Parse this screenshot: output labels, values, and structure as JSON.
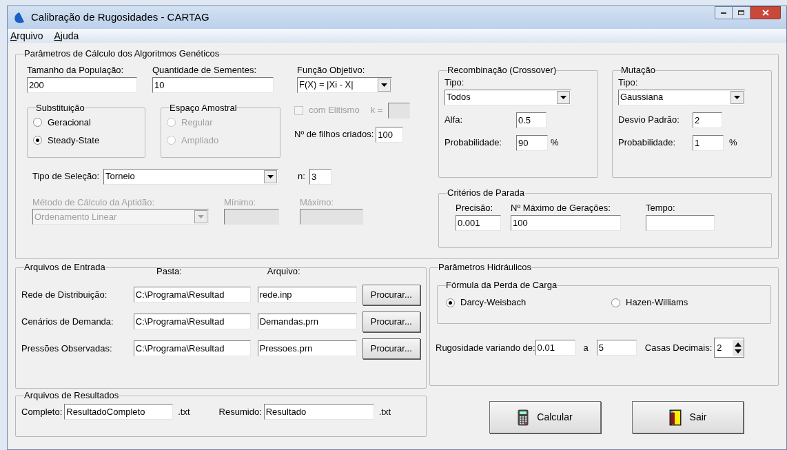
{
  "window": {
    "title": "Calibração de Rugosidades - CARTAG"
  },
  "menu": [
    "Arquivo",
    "Ajuda"
  ],
  "ga": {
    "title": "Parâmetros de Cálculo dos Algoritmos Genéticos",
    "population": {
      "label": "Tamanho da População:",
      "value": "200"
    },
    "seeds": {
      "label": "Quantidade de Sementes:",
      "value": "10"
    },
    "objective": {
      "label": "Função Objetivo:",
      "value": "F(X) = |Xi - X|"
    },
    "replacement": {
      "title": "Substituição",
      "disabled": false,
      "options": [
        {
          "label": "Geracional",
          "selected": false
        },
        {
          "label": "Steady-State",
          "selected": true
        }
      ]
    },
    "sample_space": {
      "title": "Espaço Amostral",
      "disabled": true,
      "options": [
        {
          "label": "Regular",
          "selected": false
        },
        {
          "label": "Ampliado",
          "selected": false
        }
      ]
    },
    "elitism": {
      "label": "com Elitismo",
      "checked": false,
      "disabled": true,
      "k_label": "k ="
    },
    "offspring": {
      "label": "Nº de filhos criados:",
      "value": "100"
    },
    "selection": {
      "label": "Tipo de Seleção:",
      "value": "Torneio",
      "n_label": "n:",
      "n_value": "3"
    },
    "fitness": {
      "label": "Método de Cálculo da Aptidão:",
      "value": "Ordenamento Linear",
      "disabled": true,
      "min_label": "Mínimo:",
      "max_label": "Máximo:"
    },
    "crossover": {
      "title": "Recombinação (Crossover)",
      "type_label": "Tipo:",
      "type": "Todos",
      "alpha_label": "Alfa:",
      "alpha": "0.5",
      "prob_label": "Probabilidade:",
      "prob": "90",
      "unit": "%"
    },
    "mutation": {
      "title": "Mutação",
      "type_label": "Tipo:",
      "type": "Gaussiana",
      "sd_label": "Desvio Padrão:",
      "sd": "2",
      "prob_label": "Probabilidade:",
      "prob": "1",
      "unit": "%"
    },
    "stop": {
      "title": "Critérios de Parada",
      "fields": [
        {
          "label": "Precisão:",
          "value": "0.001"
        },
        {
          "label": "Nº Máximo de Gerações:",
          "value": "100"
        },
        {
          "label": "Tempo:"
        }
      ]
    }
  },
  "input_files": {
    "title": "Arquivos de Entrada",
    "folder_heading": "Pasta:",
    "file_heading": "Arquivo:",
    "rows": [
      {
        "label": "Rede de Distribuição:",
        "folder": "C:\\Programa\\Resultad",
        "file": "rede.inp",
        "button": "Procurar..."
      },
      {
        "label": "Cenários de Demanda:",
        "folder": "C:\\Programa\\Resultad",
        "file": "Demandas.prn",
        "button": "Procurar..."
      },
      {
        "label": "Pressões Observadas:",
        "folder": "C:\\Programa\\Resultad",
        "file": "Pressoes.prn",
        "button": "Procurar..."
      }
    ]
  },
  "result_files": {
    "title": "Arquivos de Resultados",
    "fields": [
      {
        "label": "Completo:",
        "value": "ResultadoCompleto",
        "ext": ".txt"
      },
      {
        "label": "Resumido:",
        "value": "Resultado",
        "ext": ".txt"
      }
    ]
  },
  "hydraulic": {
    "title": "Parâmetros Hidráulicos",
    "formula": {
      "title": "Fórmula da Perda de Carga",
      "options": [
        {
          "label": "Darcy-Weisbach",
          "selected": true
        },
        {
          "label": "Hazen-Williams",
          "selected": false
        }
      ]
    },
    "range_label": "Rugosidade variando de:",
    "from": "0.01",
    "to_label": "a",
    "to": "5",
    "decimals_label": "Casas Decimais:",
    "decimals": "2"
  },
  "buttons": [
    {
      "label": "Calcular",
      "kind": "calculate"
    },
    {
      "label": "Sair",
      "kind": "exit"
    }
  ]
}
